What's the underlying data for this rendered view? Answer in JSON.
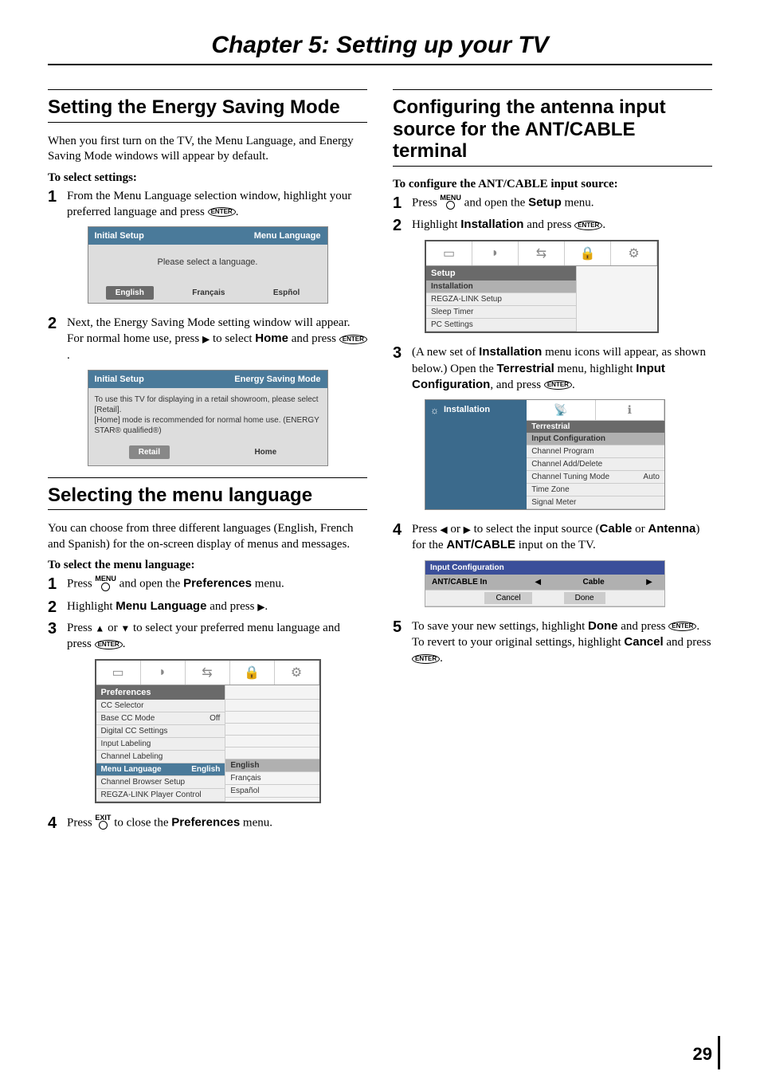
{
  "chapter_title": "Chapter 5: Setting up your TV",
  "page_number": "29",
  "left": {
    "s1": {
      "title": "Setting the Energy Saving Mode",
      "intro": "When you first turn on the TV, the Menu Language, and Energy Saving Mode windows will appear by default.",
      "lead": "To select settings:",
      "step1_a": "From the Menu Language selection window, highlight your preferred language and press ",
      "osd1": {
        "hl": "Initial Setup",
        "hr": "Menu Language",
        "body": "Please select a language.",
        "b1": "English",
        "b2": "Français",
        "b3": "Espñol"
      },
      "step2_a": "Next, the Energy Saving Mode setting window will appear. For normal home use, press ",
      "step2_b": " to select ",
      "step2_home": "Home",
      "step2_c": " and press ",
      "osd2": {
        "hl": "Initial Setup",
        "hr": "Energy Saving Mode",
        "body1": "To use this TV for displaying in a retail showroom, please select [Retail].",
        "body2": "[Home] mode is recommended for normal home use. (ENERGY STAR® qualified®)",
        "b1": "Retail",
        "b2": "Home"
      }
    },
    "s2": {
      "title": "Selecting the menu language",
      "intro": "You can choose from three different languages (English, French and Spanish) for the on-screen display of menus and messages.",
      "lead": "To select the menu language:",
      "step1_a": "Press ",
      "step1_b": " and open the ",
      "step1_pref": "Preferences",
      "step1_c": " menu.",
      "step2_a": "Highlight ",
      "step2_ml": "Menu Language",
      "step2_b": " and press ",
      "step3_a": "Press ",
      "step3_b": " or ",
      "step3_c": " to select your preferred menu language and press ",
      "osd": {
        "title": "Preferences",
        "r1": "CC Selector",
        "r2": "Base CC Mode",
        "r2v": "Off",
        "r3": "Digital CC Settings",
        "r4": "Input Labeling",
        "r5": "Channel Labeling",
        "r6": "Menu Language",
        "r6v": "English",
        "r7": "Channel Browser Setup",
        "r8": "REGZA-LINK Player Control",
        "o1": "English",
        "o2": "Français",
        "o3": "Español"
      },
      "step4_a": "Press ",
      "step4_b": " to close the ",
      "step4_pref": "Preferences",
      "step4_c": " menu."
    }
  },
  "right": {
    "s1": {
      "title": "Configuring the antenna input source for the ANT/CABLE terminal",
      "lead": "To configure the ANT/CABLE input source:",
      "step1_a": "Press ",
      "step1_b": " and open the ",
      "step1_setup": "Setup",
      "step1_c": " menu.",
      "step2_a": "Highlight ",
      "step2_inst": "Installation",
      "step2_b": " and press ",
      "osd_setup": {
        "title": "Setup",
        "r1": "Installation",
        "r2": "REGZA-LINK Setup",
        "r3": "Sleep Timer",
        "r4": "PC Settings"
      },
      "step3_a": "(A new set of ",
      "step3_inst": "Installation",
      "step3_b": " menu icons will appear, as shown below.) Open the ",
      "step3_terr": "Terrestrial",
      "step3_c": " menu, highlight ",
      "step3_ic": "Input Configuration",
      "step3_d": ", and press ",
      "osd_install": {
        "left": "Installation",
        "sub": "Terrestrial",
        "r1": "Input Configuration",
        "r2": "Channel Program",
        "r3": "Channel Add/Delete",
        "r4": "Channel Tuning Mode",
        "r4v": "Auto",
        "r5": "Time Zone",
        "r6": "Signal Meter"
      },
      "step4_a": "Press ",
      "step4_b": " or ",
      "step4_c": " to select the input source (",
      "step4_cable": "Cable",
      "step4_d": " or ",
      "step4_ant": "Antenna",
      "step4_e": ") for the ",
      "step4_ac": "ANT/CABLE",
      "step4_f": " input on the TV.",
      "osd_ic": {
        "title": "Input Configuration",
        "row_label": "ANT/CABLE In",
        "row_val": "Cable",
        "b1": "Cancel",
        "b2": "Done"
      },
      "step5_a": "To save your new settings, highlight ",
      "step5_done": "Done",
      "step5_b": " and press ",
      "step5_c": ". To revert to your original settings, highlight ",
      "step5_cancel": "Cancel",
      "step5_d": " and press "
    }
  },
  "keys": {
    "enter": "ENTER",
    "menu": "MENU",
    "exit": "EXIT"
  }
}
